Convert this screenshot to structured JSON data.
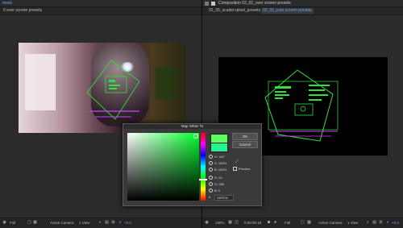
{
  "left_panel": {
    "tab": "mask",
    "subtab": "0 over screen presets",
    "footer": {
      "magnification": "Full",
      "camera": "Active Camera",
      "views": "1 View",
      "extra": "+0.0"
    }
  },
  "right_panel": {
    "tab": "Composition 02_02_over screen presets",
    "subtabs": [
      "02_05_scatter+pixel_presets",
      "02_02_over screen presets"
    ],
    "footer": {
      "zoom": "100%",
      "timecode": "0:00:00:18",
      "magnification": "Full",
      "camera": "Active Camera",
      "views": "1 View",
      "extra": "+0.0"
    }
  },
  "dialog": {
    "title": "Map White To",
    "ok": "OK",
    "cancel": "Cancel",
    "preview_label": "Preview",
    "fields": [
      {
        "label": "H:",
        "value": "115°"
      },
      {
        "label": "S:",
        "value": "100%"
      },
      {
        "label": "B:",
        "value": "100%"
      },
      {
        "label": "R:",
        "value": "24"
      },
      {
        "label": "G:",
        "value": "255"
      },
      {
        "label": "B:",
        "value": "0"
      }
    ],
    "hex_label": "#",
    "hex_value": "33FF00",
    "colors": {
      "new": "#5cff5c",
      "current": "#2bf08e"
    }
  },
  "colors": {
    "accent": "#5aa9ff",
    "panel": "#232323",
    "hud": "#2fe23a"
  }
}
